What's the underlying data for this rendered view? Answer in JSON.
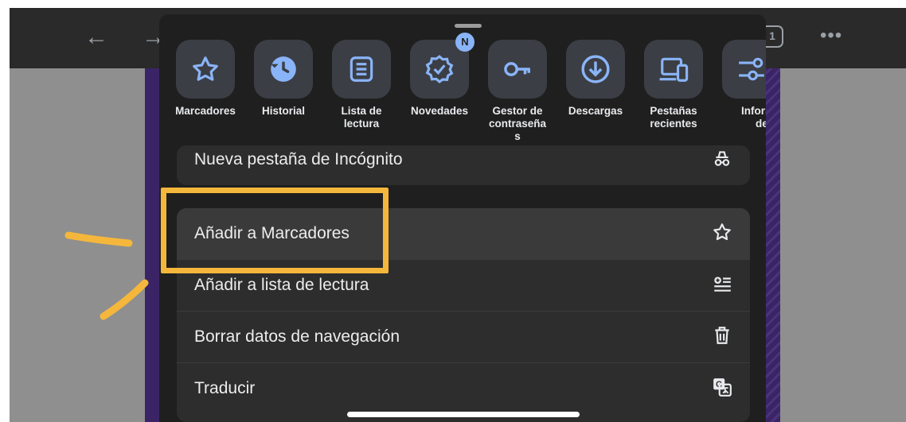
{
  "browser": {
    "back_icon": "back-arrow-icon",
    "forward_icon": "forward-arrow-icon",
    "tab_count": "1",
    "more_icon": "more-dots-icon"
  },
  "shortcuts": [
    {
      "label": "Marcadores",
      "icon": "star-icon"
    },
    {
      "label": "Historial",
      "icon": "history-icon"
    },
    {
      "label": "Lista de\nlectura",
      "icon": "reading-list-icon"
    },
    {
      "label": "Novedades",
      "icon": "whats-new-icon",
      "badge": "N"
    },
    {
      "label": "Gestor de\ncontraseña\ns",
      "icon": "key-icon"
    },
    {
      "label": "Descargas",
      "icon": "download-icon"
    },
    {
      "label": "Pestañas\nrecientes",
      "icon": "devices-icon"
    },
    {
      "label": "Informac\ndel sit\nweb",
      "icon": "site-info-icon"
    }
  ],
  "menu": {
    "incognito": {
      "label": "Nueva pestaña de Incógnito",
      "icon": "incognito-icon"
    },
    "items": [
      {
        "label": "Añadir a Marcadores",
        "icon": "star-outline-icon"
      },
      {
        "label": "Añadir a lista de lectura",
        "icon": "add-reading-list-icon"
      },
      {
        "label": "Borrar datos de navegación",
        "icon": "trash-icon"
      },
      {
        "label": "Traducir",
        "icon": "translate-icon"
      }
    ]
  },
  "annotation_color": "#f5b73b",
  "accent_color": "#8ab4f8"
}
